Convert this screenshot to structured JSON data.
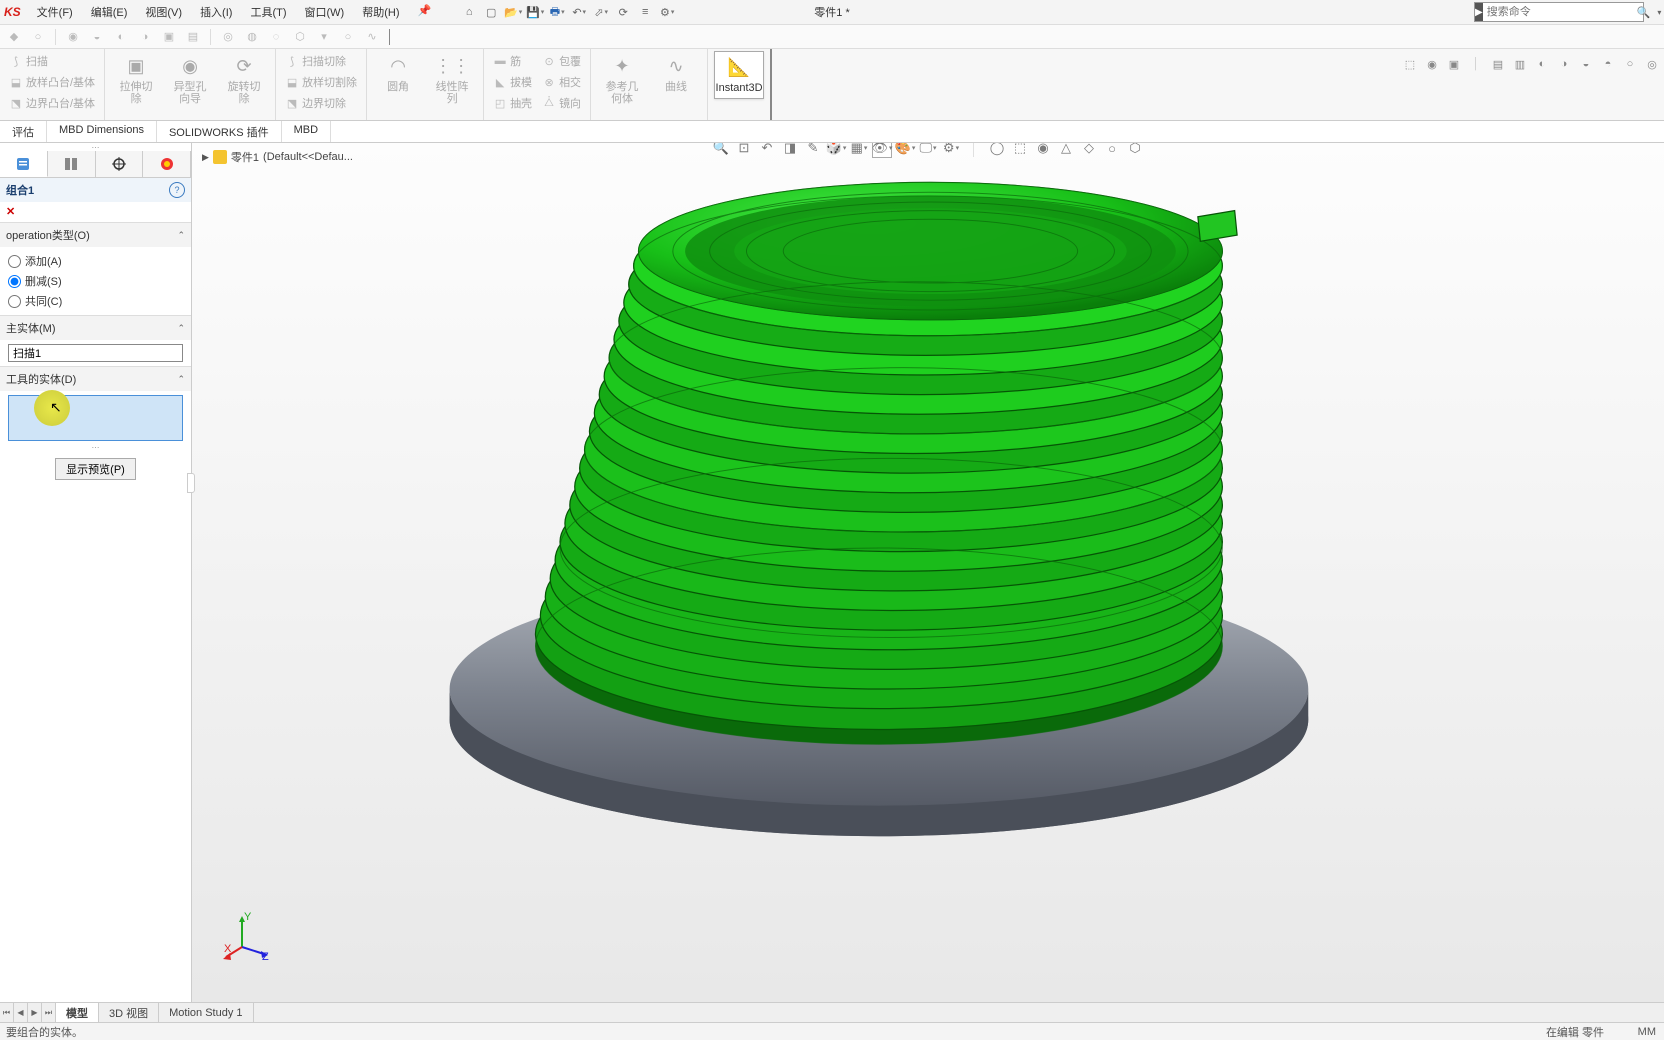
{
  "app": {
    "logo": "KS",
    "doc_title": "零件1 *"
  },
  "menu": {
    "file": "文件(F)",
    "edit": "编辑(E)",
    "view": "视图(V)",
    "insert": "插入(I)",
    "tools": "工具(T)",
    "window": "窗口(W)",
    "help": "帮助(H)"
  },
  "search": {
    "placeholder": "搜索命令"
  },
  "ribbon": {
    "g1": {
      "sweep": "扫描",
      "loft": "放样凸台/基体",
      "boundary": "边界凸台/基体"
    },
    "g2": {
      "extrude_cut": "拉伸切除",
      "hole_wizard": "异型孔向导",
      "revolve_cut": "旋转切除"
    },
    "g3": {
      "swept_cut": "扫描切除",
      "loft_cut": "放样切割除",
      "boundary_cut": "边界切除"
    },
    "g4": {
      "fillet": "圆角",
      "pattern": "线性阵列"
    },
    "g5": {
      "rib": "筋",
      "draft": "拔模",
      "shell": "抽壳"
    },
    "g6": {
      "wrap": "包覆",
      "intersect": "相交",
      "mirror": "镜向"
    },
    "g7": {
      "ref_geom": "参考几何体",
      "curves": "曲线"
    },
    "instant3d": "Instant3D"
  },
  "cmd_tabs": {
    "evaluate": "评估",
    "mbd_dim": "MBD Dimensions",
    "sw_addins": "SOLIDWORKS 插件",
    "mbd": "MBD"
  },
  "pm": {
    "title": "组合1",
    "sec_type": "operation类型(O)",
    "radio_add": "添加(A)",
    "radio_sub": "删减(S)",
    "radio_common": "共同(C)",
    "sec_main": "主实体(M)",
    "main_value": "扫描1",
    "sec_tool": "工具的实体(D)",
    "show_preview": "显示预览(P)"
  },
  "breadcrumb": {
    "part": "零件1",
    "config": "(Default<<Defau..."
  },
  "bot_tabs": {
    "model": "模型",
    "view3d": "3D 视图",
    "motion": "Motion Study 1"
  },
  "status": {
    "hint": "要组合的实体。",
    "editing": "在编辑 零件",
    "units": "MM"
  }
}
